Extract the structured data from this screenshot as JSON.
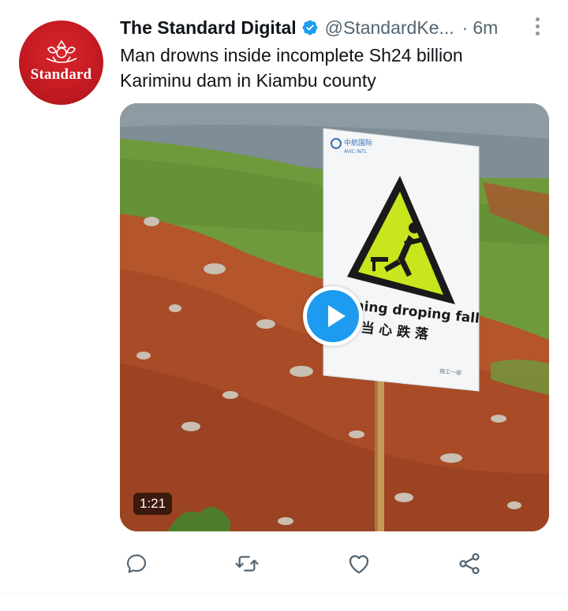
{
  "account": {
    "display_name": "The Standard Digital",
    "handle": "@StandardKe...",
    "separator": "·",
    "timestamp": "6m",
    "verified": true,
    "avatar_text": "Standard",
    "avatar_color": "#c21a22"
  },
  "tweet": {
    "text_line_1": "Man drowns inside incomplete Sh24 billion",
    "text_line_2": "Kariminu dam in Kiambu county"
  },
  "media": {
    "type": "video",
    "duration": "1:21",
    "sign_logo_line_1": "中航国际",
    "sign_logo_line_2": "AVIC INTL",
    "sign_text_english": "ning droping fall",
    "sign_text_chinese": "当 心 跌 落",
    "sign_footer": "施工一部"
  },
  "actions": [
    {
      "name": "reply",
      "icon": "reply-icon"
    },
    {
      "name": "retweet",
      "icon": "retweet-icon"
    },
    {
      "name": "like",
      "icon": "heart-icon"
    },
    {
      "name": "share",
      "icon": "share-icon"
    }
  ],
  "colors": {
    "accent": "#1d9bf0",
    "text_primary": "#0f1419",
    "text_secondary": "#536471"
  }
}
